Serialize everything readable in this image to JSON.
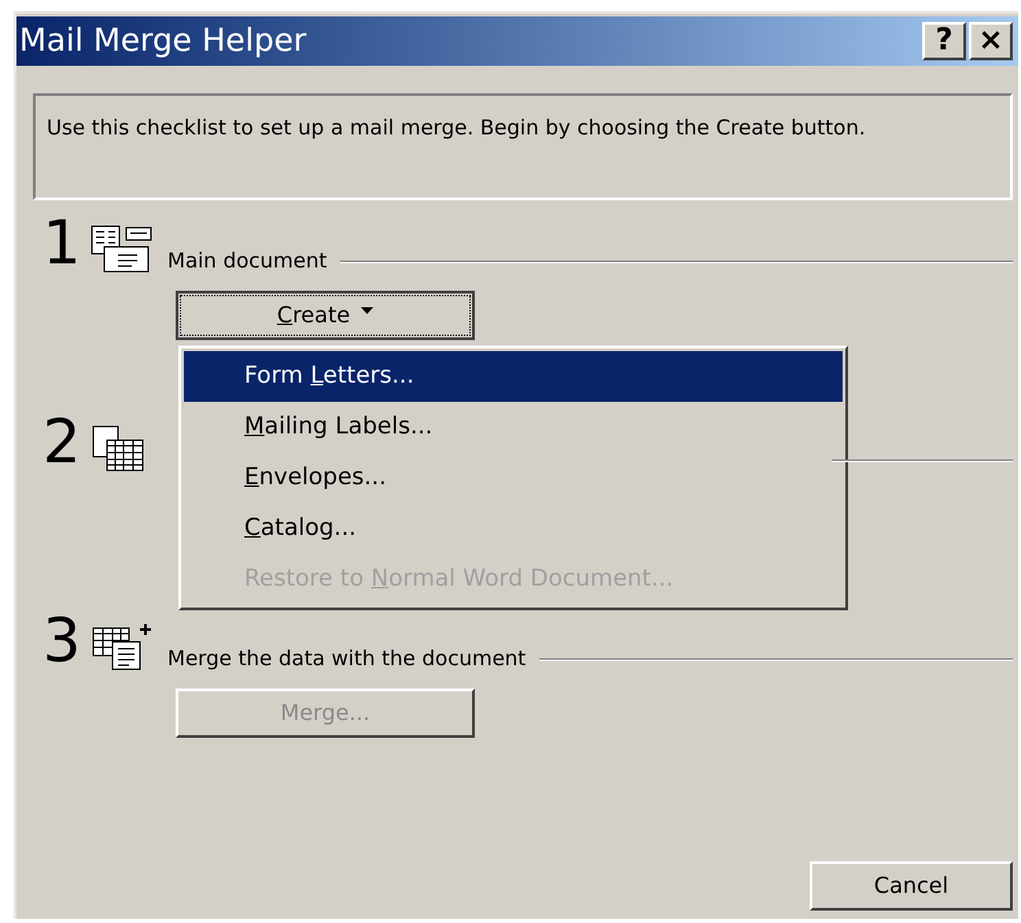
{
  "window": {
    "title": "Mail Merge Helper"
  },
  "title_buttons": [
    "?",
    "×"
  ],
  "instructions": "Use this checklist to set up a mail merge. Begin by choosing the Create button.",
  "steps": [
    {
      "number": "1",
      "label": "Main document",
      "button": {
        "label": {
          "key": "C",
          "after": "reate"
        },
        "disabled": false,
        "focused": true,
        "dropdown": true
      }
    },
    {
      "number": "2"
    },
    {
      "number": "3",
      "label": "Merge the data with the document",
      "button": {
        "label": {
          "before": "Merge..."
        },
        "disabled": true,
        "focused": false,
        "dropdown": false
      }
    }
  ],
  "menu": {
    "items": [
      {
        "label": {
          "before": "Form ",
          "key": "L",
          "after": "etters..."
        },
        "selected": true,
        "disabled": false
      },
      {
        "label": {
          "key": "M",
          "after": "ailing Labels..."
        },
        "selected": false,
        "disabled": false
      },
      {
        "label": {
          "key": "E",
          "after": "nvelopes..."
        },
        "selected": false,
        "disabled": false
      },
      {
        "label": {
          "key": "C",
          "after": "atalog..."
        },
        "selected": false,
        "disabled": false
      },
      {
        "label": {
          "before": "Restore to ",
          "key": "N",
          "after": "ormal Word Document..."
        },
        "selected": false,
        "disabled": true
      }
    ]
  },
  "buttons": [
    {
      "label": "Cancel"
    }
  ]
}
